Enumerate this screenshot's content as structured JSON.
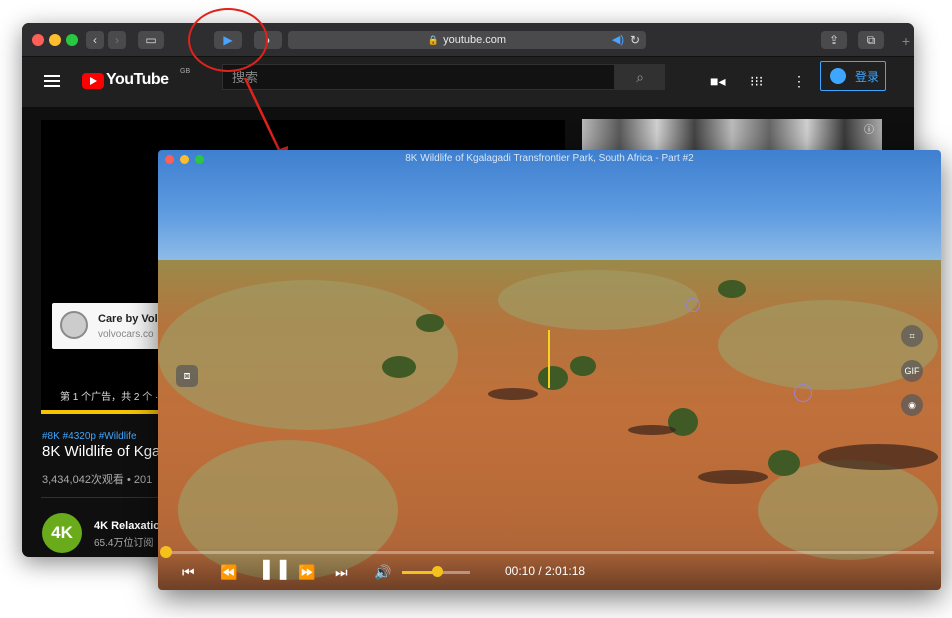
{
  "browser": {
    "url": "youtube.com",
    "colors": {
      "close": "#ff5f57",
      "minimize": "#febc2e",
      "zoom": "#28c840"
    }
  },
  "youtube": {
    "logo_text": "YouTube",
    "region": "GB",
    "search_placeholder": "搜索",
    "signin_label": "登录",
    "ad": {
      "title": "Care by Vol",
      "url": "volvocars.co",
      "count_text": "第 1 个广告，共 2 个 ·"
    },
    "video": {
      "tags": "#8K #4320p #Wildlife",
      "title": "8K Wildlife of Kga",
      "views": "3,434,042次观看 • 201"
    },
    "channel": {
      "avatar_text": "4K",
      "name": "4K Relaxatio",
      "subs": "65.4万位订阅"
    }
  },
  "pip": {
    "title": "8K Wildlife of Kgalagadi Transfrontier Park, South Africa - Part #2",
    "time": "00:10 / 2:01:18",
    "progress": 0.0014,
    "volume": 0.5,
    "side_buttons": [
      "crop-icon",
      "GIF",
      "record-icon"
    ],
    "gif_label": "GIF"
  },
  "annotation": {
    "color": "#e0221b"
  }
}
